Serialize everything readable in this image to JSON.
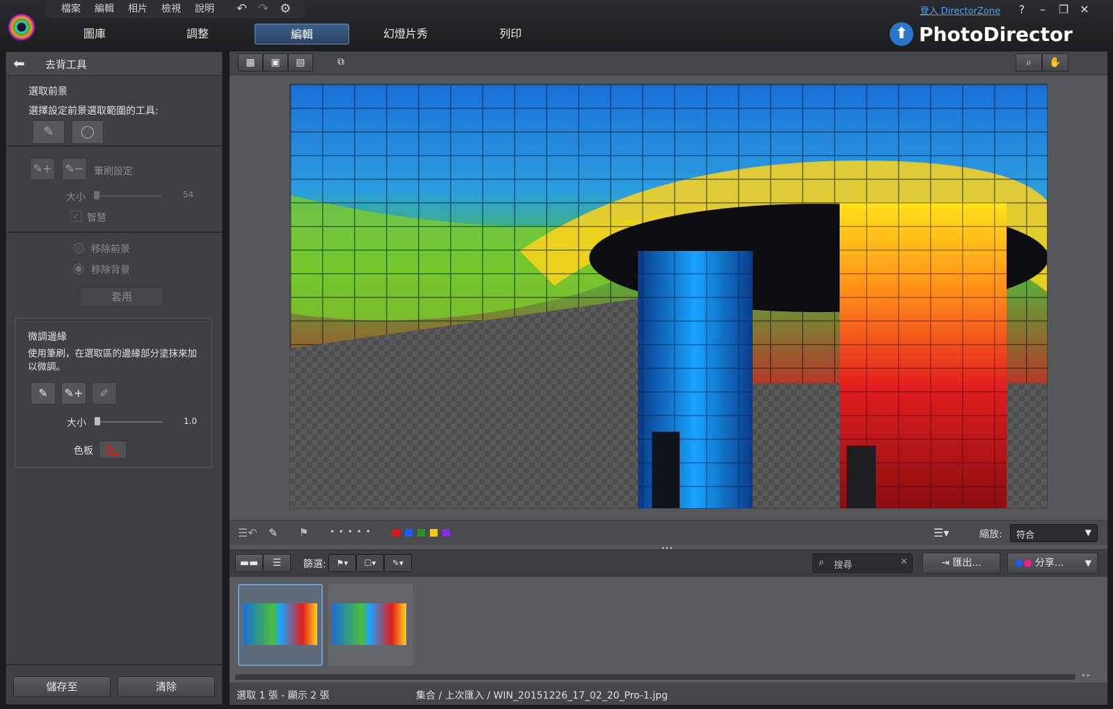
{
  "menu": {
    "items": [
      "檔案",
      "編輯",
      "相片",
      "檢視",
      "說明"
    ]
  },
  "modules": {
    "library": "圖庫",
    "adjust": "調整",
    "edit": "編輯",
    "slideshow": "幻燈片秀",
    "print": "列印"
  },
  "header": {
    "directorzone": "登入 DirectorZone",
    "help": "?",
    "brand": "PhotoDirector"
  },
  "panel": {
    "title": "去背工具",
    "select_fg": "選取前景",
    "select_desc": "選擇設定前景選取範圍的工具:",
    "brush_settings": "筆刷設定",
    "size_label": "大小",
    "size_value1": "54",
    "smart": "智慧",
    "remove_fg": "移除前景",
    "remove_bg": "移除背景",
    "apply": "套用",
    "refine_title": "微調邊緣",
    "refine_desc": "使用筆刷，在選取區的邊緣部分塗抹來加以微調。",
    "size_value2": "1.0",
    "palette_label": "色板",
    "save_to": "儲存至",
    "clear": "清除"
  },
  "editbar": {
    "zoom_label": "縮放:",
    "zoom_value": "符合",
    "dots": "• • • • •"
  },
  "colors": {
    "red": "#e8141b",
    "blue": "#1a5cf0",
    "green": "#2b8c2b",
    "yellow": "#f2c80f",
    "purple": "#8a2be2",
    "accent": "#2a77c9"
  },
  "browse": {
    "filter_label": "篩選:",
    "search_placeholder": "搜尋",
    "export": "匯出...",
    "share": "分享..."
  },
  "status": {
    "selection": "選取 1 張 - 顯示 2 張",
    "path": "集合 / 上次匯入 / WIN_20151226_17_02_20_Pro-1.jpg"
  }
}
